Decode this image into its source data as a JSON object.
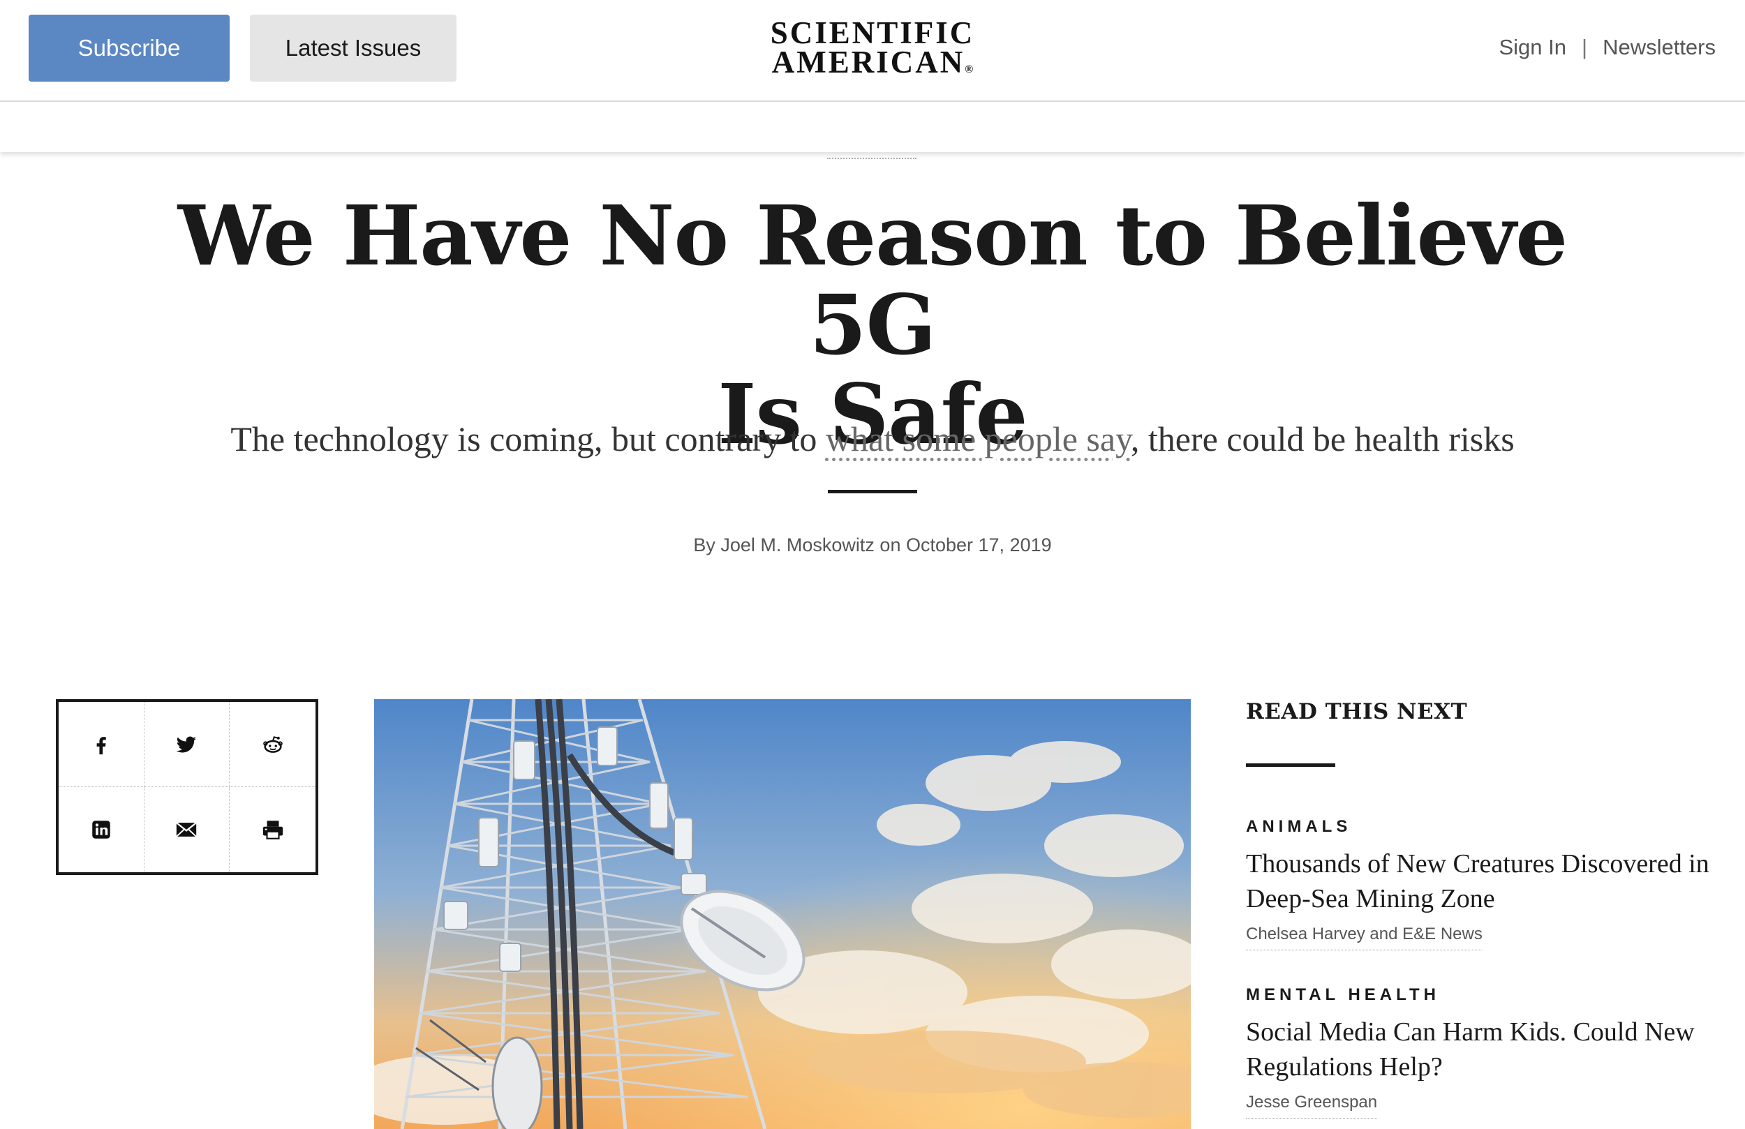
{
  "header": {
    "subscribe_label": "Subscribe",
    "latest_issues_label": "Latest Issues",
    "logo_line1": "SCIENTIFIC",
    "logo_line2": "AMERICAN",
    "logo_mark": "®",
    "sign_in_label": "Sign In",
    "separator": "|",
    "newsletters_label": "Newsletters"
  },
  "article": {
    "headline_line1": "We Have No Reason to Believe 5G",
    "headline_line2": "Is Safe",
    "dek_before": "The technology is coming, but contrary to ",
    "dek_link": "what some people say",
    "dek_after": ", there could be health risks",
    "byline": "By Joel M. Moskowitz on October 17, 2019"
  },
  "share": {
    "icons": [
      "facebook-icon",
      "twitter-icon",
      "reddit-icon",
      "linkedin-icon",
      "email-icon",
      "print-icon"
    ]
  },
  "hero_image": {
    "subject": "cell tower with antennas and satellite dish against a sunset sky"
  },
  "sidebar": {
    "title": "READ THIS NEXT",
    "items": [
      {
        "category": "ANIMALS",
        "headline": "Thousands of New Creatures Discovered in Deep-Sea Mining Zone",
        "author": "Chelsea Harvey and E&E News"
      },
      {
        "category": "MENTAL HEALTH",
        "headline": "Social Media Can Harm Kids. Could New Regulations Help?",
        "author": "Jesse Greenspan"
      }
    ]
  },
  "colors": {
    "subscribe_bg": "#5b88c3",
    "latest_bg": "#e5e5e5",
    "text": "#1a1a1a"
  }
}
